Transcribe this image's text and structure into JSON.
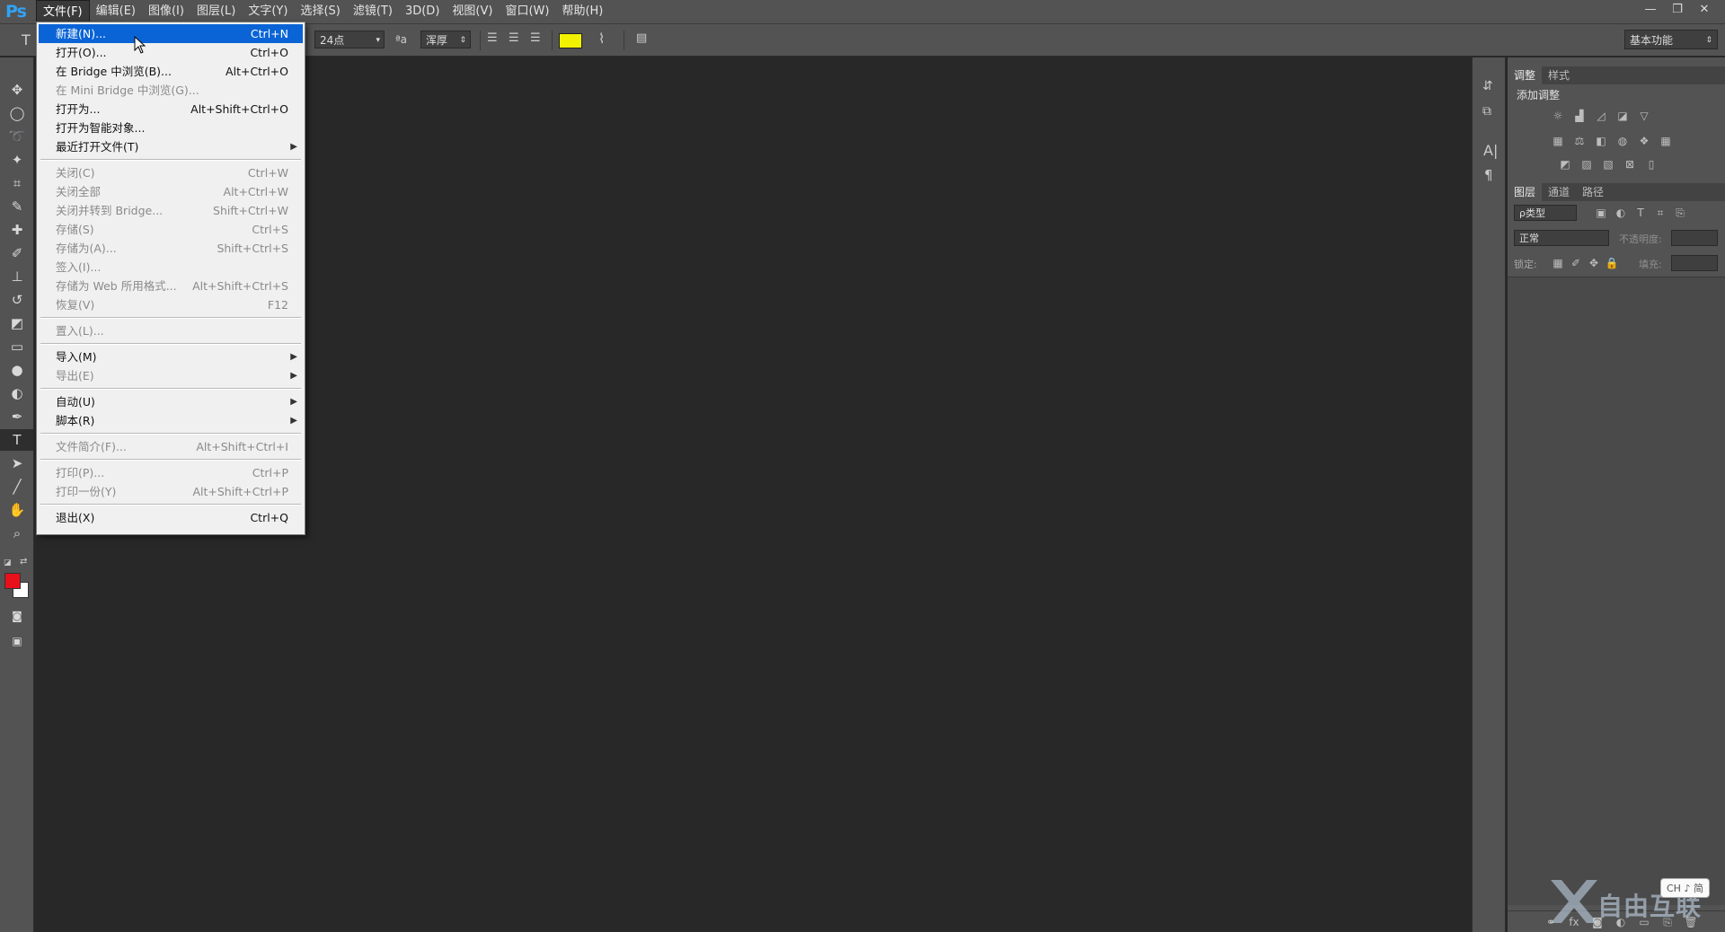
{
  "app": {
    "logo": "Ps"
  },
  "menubar": {
    "items": [
      "文件(F)",
      "编辑(E)",
      "图像(I)",
      "图层(L)",
      "文字(Y)",
      "选择(S)",
      "滤镜(T)",
      "3D(D)",
      "视图(V)",
      "窗口(W)",
      "帮助(H)"
    ],
    "active_index": 0
  },
  "window_controls": {
    "minimize": "—",
    "restore": "❐",
    "close": "✕"
  },
  "options": {
    "tool_glyph": "T",
    "font_size": "24点",
    "aa_glyph": "ªa",
    "antialias": "浑厚",
    "text_color": "#f2f200",
    "workspace": "基本功能"
  },
  "file_menu": {
    "items": [
      {
        "label": "新建(N)...",
        "shortcut": "Ctrl+N",
        "enabled": true,
        "highlighted": true
      },
      {
        "label": "打开(O)...",
        "shortcut": "Ctrl+O",
        "enabled": true
      },
      {
        "label": "在 Bridge 中浏览(B)...",
        "shortcut": "Alt+Ctrl+O",
        "enabled": true
      },
      {
        "label": "在 Mini Bridge 中浏览(G)...",
        "shortcut": "",
        "enabled": false
      },
      {
        "label": "打开为...",
        "shortcut": "Alt+Shift+Ctrl+O",
        "enabled": true
      },
      {
        "label": "打开为智能对象...",
        "shortcut": "",
        "enabled": true
      },
      {
        "label": "最近打开文件(T)",
        "shortcut": "",
        "enabled": true,
        "submenu": true
      },
      {
        "label": "关闭(C)",
        "shortcut": "Ctrl+W",
        "enabled": false
      },
      {
        "label": "关闭全部",
        "shortcut": "Alt+Ctrl+W",
        "enabled": false
      },
      {
        "label": "关闭并转到 Bridge...",
        "shortcut": "Shift+Ctrl+W",
        "enabled": false
      },
      {
        "label": "存储(S)",
        "shortcut": "Ctrl+S",
        "enabled": false
      },
      {
        "label": "存储为(A)...",
        "shortcut": "Shift+Ctrl+S",
        "enabled": false
      },
      {
        "label": "签入(I)...",
        "shortcut": "",
        "enabled": false
      },
      {
        "label": "存储为 Web 所用格式...",
        "shortcut": "Alt+Shift+Ctrl+S",
        "enabled": false
      },
      {
        "label": "恢复(V)",
        "shortcut": "F12",
        "enabled": false
      },
      {
        "label": "置入(L)...",
        "shortcut": "",
        "enabled": false
      },
      {
        "label": "导入(M)",
        "shortcut": "",
        "enabled": true,
        "submenu": true
      },
      {
        "label": "导出(E)",
        "shortcut": "",
        "enabled": false,
        "submenu": true
      },
      {
        "label": "自动(U)",
        "shortcut": "",
        "enabled": true,
        "submenu": true
      },
      {
        "label": "脚本(R)",
        "shortcut": "",
        "enabled": true,
        "submenu": true
      },
      {
        "label": "文件简介(F)...",
        "shortcut": "Alt+Shift+Ctrl+I",
        "enabled": false
      },
      {
        "label": "打印(P)...",
        "shortcut": "Ctrl+P",
        "enabled": false
      },
      {
        "label": "打印一份(Y)",
        "shortcut": "Alt+Shift+Ctrl+P",
        "enabled": false
      },
      {
        "label": "退出(X)",
        "shortcut": "Ctrl+Q",
        "enabled": true
      }
    ]
  },
  "adjust_panel": {
    "tabs": [
      "调整",
      "样式"
    ],
    "title": "添加调整"
  },
  "layers_panel": {
    "tabs": [
      "图层",
      "通道",
      "路径"
    ],
    "filter_label": "ρ类型",
    "blend_mode": "正常",
    "opacity_label": "不透明度:",
    "lock_label": "锁定:",
    "fill_label": "填充:"
  },
  "colors": {
    "foreground": "#e8101a",
    "background": "#ffffff",
    "menu_highlight": "#0a64d6",
    "logo": "#2fa3f5"
  },
  "watermark": {
    "text": "自由互联",
    "badge": "CH ♪ 简"
  }
}
